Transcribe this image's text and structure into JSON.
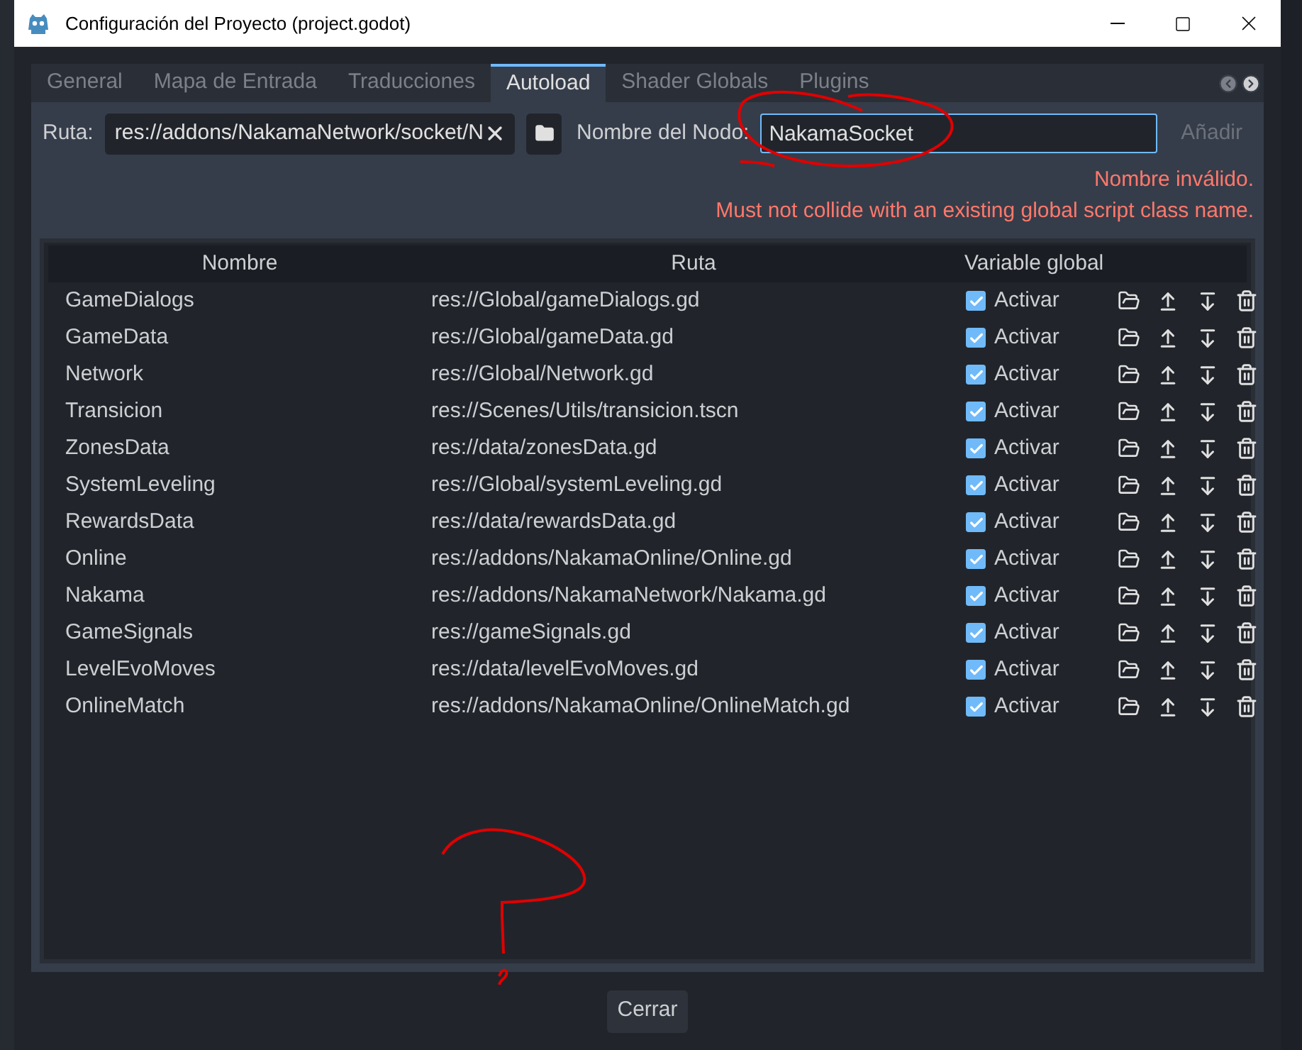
{
  "window": {
    "title": "Configuración del Proyecto (project.godot)"
  },
  "tabs": [
    {
      "label": "General",
      "selected": false
    },
    {
      "label": "Mapa de Entrada",
      "selected": false
    },
    {
      "label": "Traducciones",
      "selected": false
    },
    {
      "label": "Autoload",
      "selected": true
    },
    {
      "label": "Shader Globals",
      "selected": false
    },
    {
      "label": "Plugins",
      "selected": false
    }
  ],
  "path_field": {
    "label": "Ruta:",
    "value": "res://addons/NakamaNetwork/socket/N"
  },
  "node_name_field": {
    "label": "Nombre del Nodo:",
    "value": "NakamaSocket",
    "focused": true
  },
  "add_button": {
    "label": "Añadir",
    "disabled": true
  },
  "errors": [
    "Nombre inválido.",
    "Must not collide with an existing global script class name."
  ],
  "table": {
    "columns": [
      "Nombre",
      "Ruta",
      "Variable global"
    ],
    "rows": [
      {
        "name": "GameDialogs",
        "path": "res://Global/gameDialogs.gd",
        "checked": true,
        "toggle_label": "Activar"
      },
      {
        "name": "GameData",
        "path": "res://Global/gameData.gd",
        "checked": true,
        "toggle_label": "Activar"
      },
      {
        "name": "Network",
        "path": "res://Global/Network.gd",
        "checked": true,
        "toggle_label": "Activar"
      },
      {
        "name": "Transicion",
        "path": "res://Scenes/Utils/transicion.tscn",
        "checked": true,
        "toggle_label": "Activar"
      },
      {
        "name": "ZonesData",
        "path": "res://data/zonesData.gd",
        "checked": true,
        "toggle_label": "Activar"
      },
      {
        "name": "SystemLeveling",
        "path": "res://Global/systemLeveling.gd",
        "checked": true,
        "toggle_label": "Activar"
      },
      {
        "name": "RewardsData",
        "path": "res://data/rewardsData.gd",
        "checked": true,
        "toggle_label": "Activar"
      },
      {
        "name": "Online",
        "path": "res://addons/NakamaOnline/Online.gd",
        "checked": true,
        "toggle_label": "Activar"
      },
      {
        "name": "Nakama",
        "path": "res://addons/NakamaNetwork/Nakama.gd",
        "checked": true,
        "toggle_label": "Activar"
      },
      {
        "name": "GameSignals",
        "path": "res://gameSignals.gd",
        "checked": true,
        "toggle_label": "Activar"
      },
      {
        "name": "LevelEvoMoves",
        "path": "res://data/levelEvoMoves.gd",
        "checked": true,
        "toggle_label": "Activar"
      },
      {
        "name": "OnlineMatch",
        "path": "res://addons/NakamaOnline/OnlineMatch.gd",
        "checked": true,
        "toggle_label": "Activar"
      }
    ]
  },
  "close_button": {
    "label": "Cerrar"
  }
}
